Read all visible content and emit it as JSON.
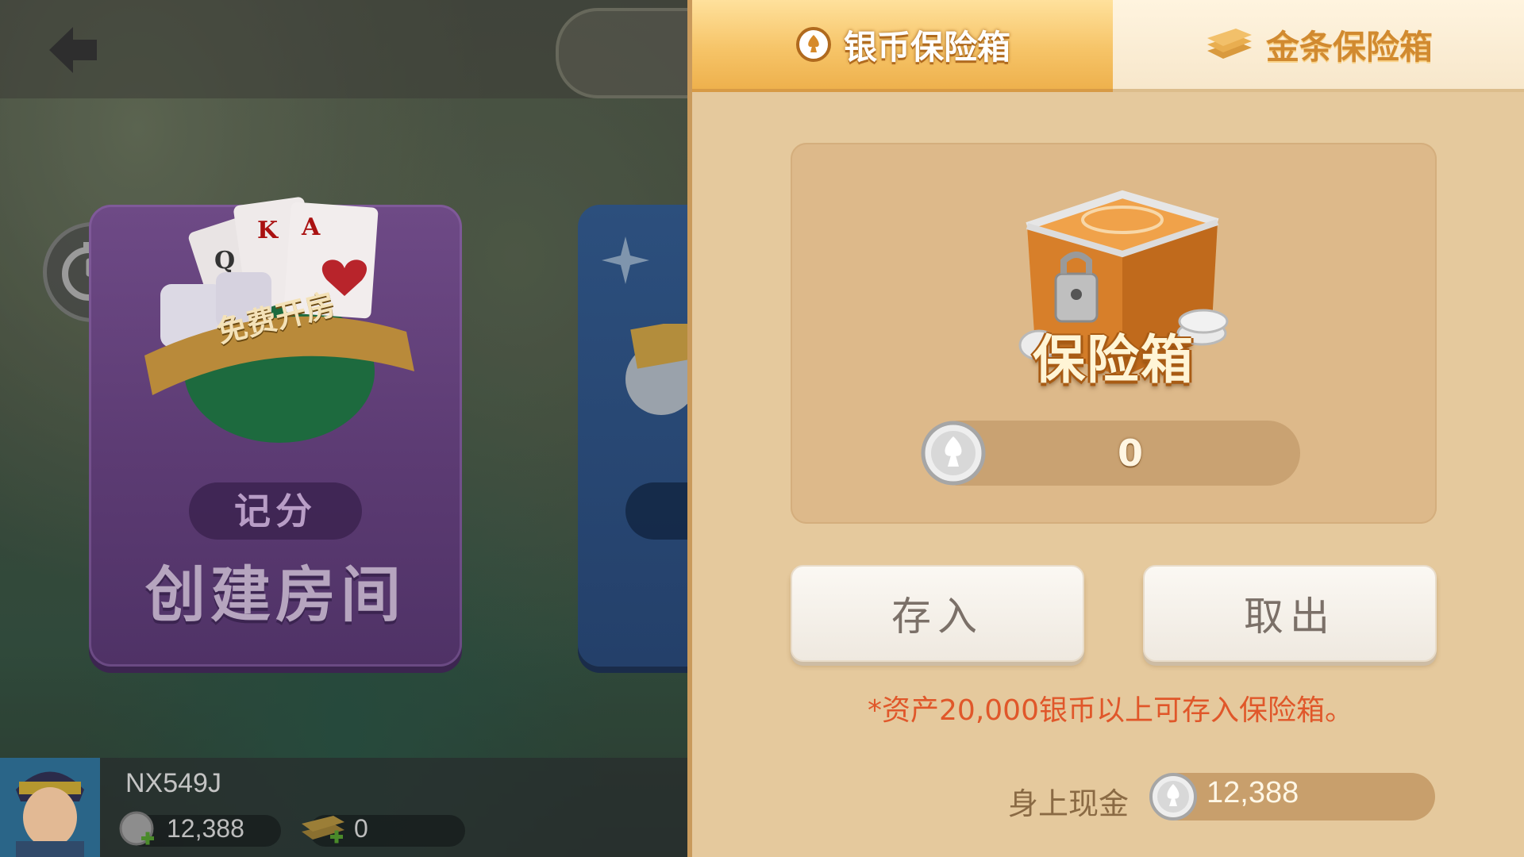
{
  "lobby": {
    "cards": [
      {
        "banner": "免费开房",
        "tag": "记分",
        "title": "创建房间"
      }
    ],
    "player": {
      "name": "NX549J",
      "silver": "12,388",
      "gold": "0"
    }
  },
  "safe_panel": {
    "tabs": [
      {
        "label": "银币保险箱",
        "icon": "silver-coin-icon",
        "active": true
      },
      {
        "label": "金条保险箱",
        "icon": "gold-bar-icon",
        "active": false
      }
    ],
    "chest_label": "保险箱",
    "stored_amount": "0",
    "buttons": {
      "deposit": "存入",
      "withdraw": "取出"
    },
    "hint": "*资产20,000银币以上可存入保险箱。",
    "cash": {
      "label": "身上现金",
      "value": "12,388"
    },
    "colors": {
      "panel_bg": "#e5c99d",
      "active_tab": "#f6c468",
      "hint_text": "#e0572a"
    }
  }
}
